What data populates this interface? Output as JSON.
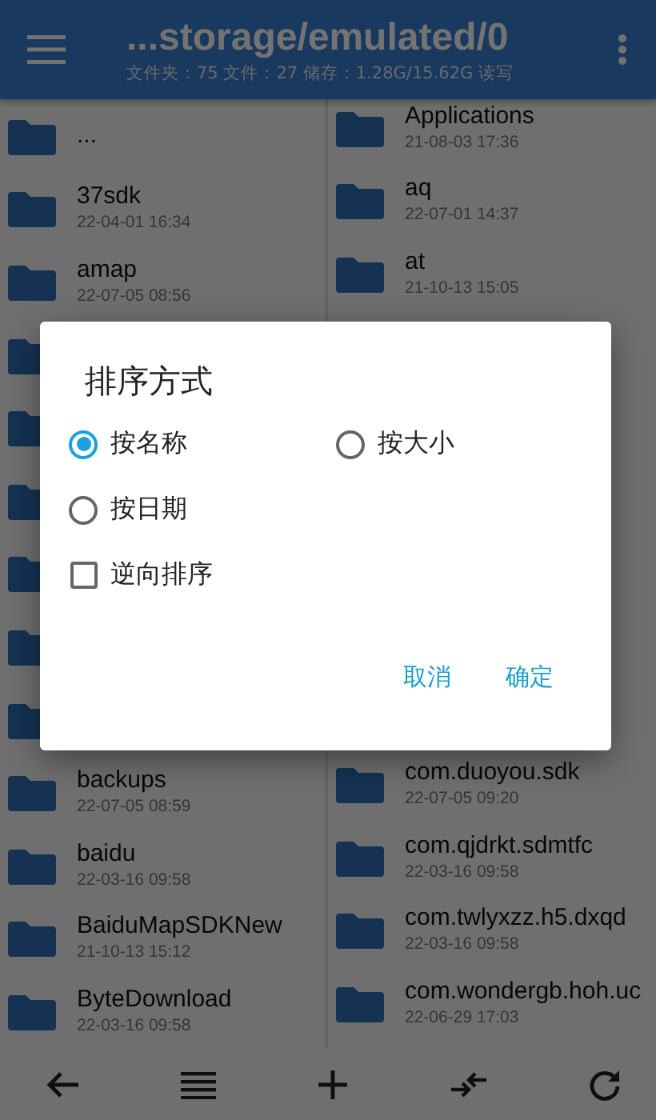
{
  "toolbar": {
    "title": "...storage/emulated/0",
    "subtitle": "文件夹：75 文件：27 储存：1.28G/15.62G  读写"
  },
  "left_pane": {
    "rows": [
      {
        "kind": "folder",
        "name": "..."
      },
      {
        "kind": "folder",
        "name": "37sdk",
        "date": "22-04-01 16:34"
      },
      {
        "kind": "folder",
        "name": "amap",
        "date": "22-07-05 08:56"
      },
      {
        "kind": "covered"
      },
      {
        "kind": "covered"
      },
      {
        "kind": "covered"
      },
      {
        "kind": "covered"
      },
      {
        "kind": "covered"
      },
      {
        "kind": "covered"
      },
      {
        "kind": "folder",
        "name": "backups",
        "date": "22-07-05 08:59"
      },
      {
        "kind": "folder",
        "name": "baidu",
        "date": "22-03-16 09:58"
      },
      {
        "kind": "folder",
        "name": "BaiduMapSDKNew",
        "date": "21-10-13 15:12"
      },
      {
        "kind": "folder",
        "name": "ByteDownload",
        "date": "22-03-16 09:58"
      }
    ]
  },
  "right_pane": {
    "rows": [
      {
        "kind": "folder",
        "name": "Applications",
        "date": "21-08-03 17:36"
      },
      {
        "kind": "folder",
        "name": "aq",
        "date": "22-07-01 14:37"
      },
      {
        "kind": "folder",
        "name": "at",
        "date": "21-10-13 15:05"
      },
      {
        "kind": "gap"
      },
      {
        "kind": "gap"
      },
      {
        "kind": "gap"
      },
      {
        "kind": "gap"
      },
      {
        "kind": "gap"
      },
      {
        "kind": "gap"
      },
      {
        "kind": "folder",
        "name": "com.duoyou.sdk",
        "date": "22-07-05 09:20"
      },
      {
        "kind": "folder",
        "name": "com.qjdrkt.sdmtfc",
        "date": "22-03-16 09:58"
      },
      {
        "kind": "folder",
        "name": "com.twlyxzz.h5.dxqd",
        "date": "22-03-16 09:58"
      },
      {
        "kind": "folder",
        "name": "com.wondergb.hoh.uc",
        "date": "22-06-29 17:03"
      }
    ]
  },
  "bottom_bar": [
    {
      "kind": "back"
    },
    {
      "kind": "list"
    },
    {
      "kind": "add"
    },
    {
      "kind": "swap"
    },
    {
      "kind": "refresh"
    }
  ],
  "dialog": {
    "title": "排序方式",
    "options": [
      {
        "label": "按名称",
        "selected": true
      },
      {
        "label": "按大小",
        "selected": false
      },
      {
        "label": "按日期",
        "selected": false
      }
    ],
    "reverse_sort": {
      "label": "逆向排序",
      "checked": false
    },
    "buttons": [
      "取消",
      "确定"
    ]
  }
}
